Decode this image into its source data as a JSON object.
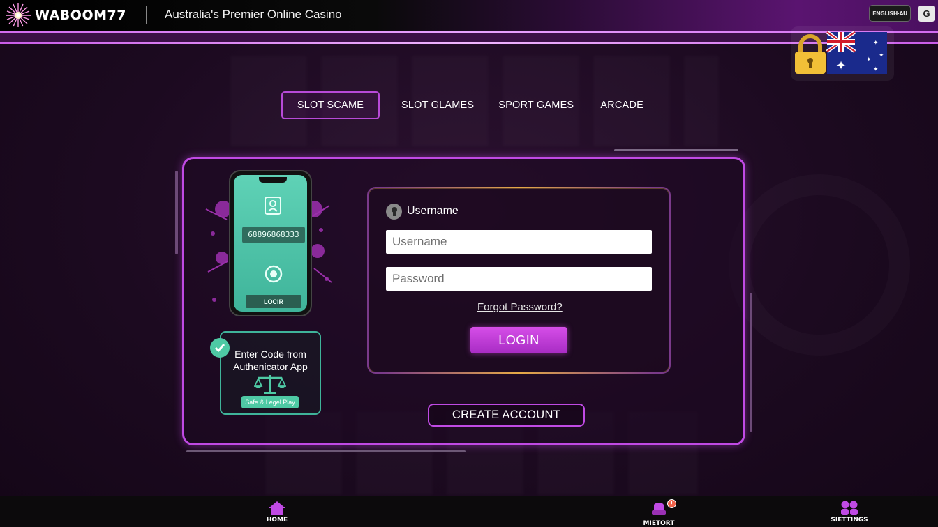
{
  "header": {
    "brand": "WABOOM77",
    "tagline": "Australia's Premier Online Casino",
    "language_button": "ENGLISH·AU",
    "translate_icon_glyph": "G",
    "accent_color": "#c04ae4"
  },
  "tabs": [
    {
      "label": "SLOT SCAME",
      "active": true
    },
    {
      "label": "SLOT GLAMES",
      "active": false
    },
    {
      "label": "SPORT GAMES",
      "active": false
    },
    {
      "label": "ARCADE",
      "active": false
    }
  ],
  "phone": {
    "code": "68896868333",
    "login_label": "LOCIR"
  },
  "authenticator": {
    "line1": "Enter Code from",
    "line2": "Authenicator App",
    "badge": "Safe & Legel Play"
  },
  "login": {
    "section_label": "Username",
    "username_placeholder": "Username",
    "password_placeholder": "Password",
    "forgot_label": "Forgot Password?",
    "login_button": "LOGIN",
    "create_account_button": "CREATE ACCOUNT"
  },
  "bottom_nav": {
    "home": "HOME",
    "support": "MIETORT",
    "support_badge": "!",
    "settings": "SIETTINGS"
  }
}
